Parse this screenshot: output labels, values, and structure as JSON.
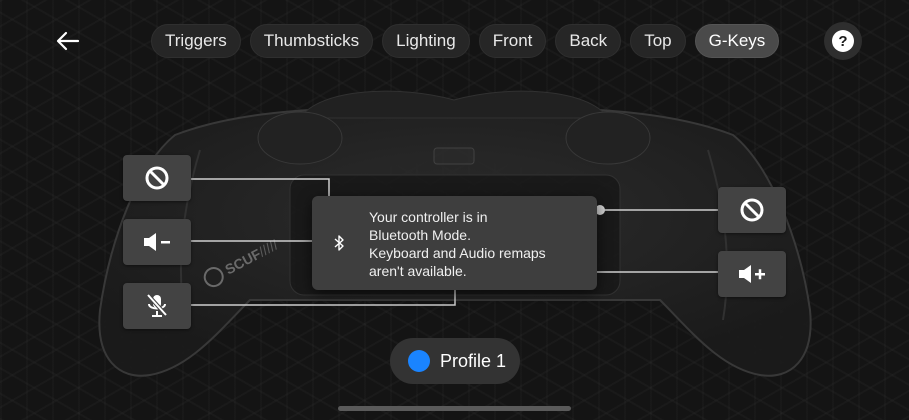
{
  "header": {
    "tabs": [
      {
        "label": "Triggers"
      },
      {
        "label": "Thumbsticks"
      },
      {
        "label": "Lighting"
      },
      {
        "label": "Front"
      },
      {
        "label": "Back"
      },
      {
        "label": "Top"
      },
      {
        "label": "G-Keys"
      }
    ],
    "active_tab": "G-Keys",
    "help_label": "?"
  },
  "keys": {
    "left_top": {
      "icon": "no-symbol-icon"
    },
    "left_middle": {
      "icon": "volume-down-icon"
    },
    "left_bottom": {
      "icon": "mic-mute-icon"
    },
    "right_top": {
      "icon": "no-symbol-icon"
    },
    "right_bottom": {
      "icon": "volume-up-icon"
    }
  },
  "toast": {
    "icon": "bluetooth-icon",
    "message": "Your controller is in\nBluetooth Mode.\nKeyboard and Audio remaps\naren't available."
  },
  "profile": {
    "label": "Profile 1",
    "color": "#1a84ff"
  },
  "controller": {
    "brand_text": "SCUF"
  },
  "colors": {
    "background": "#141414",
    "key_bg": "#434343",
    "tab_active": "#4a4a4a"
  }
}
